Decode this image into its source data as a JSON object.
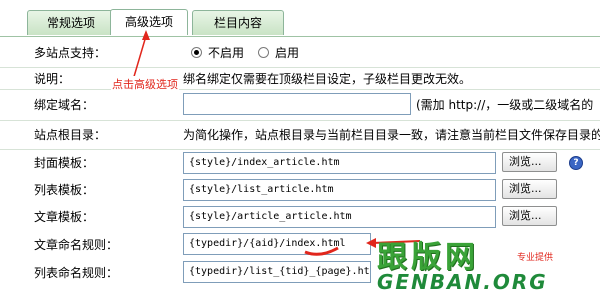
{
  "tabs": [
    {
      "label": "常规选项",
      "active": false
    },
    {
      "label": "高级选项",
      "active": true
    },
    {
      "label": "栏目内容",
      "active": false
    }
  ],
  "multisite": {
    "label": "多站点支持：",
    "options": [
      {
        "label": "不启用",
        "checked": true
      },
      {
        "label": "启用",
        "checked": false
      }
    ]
  },
  "note": {
    "label": "说明：",
    "text": "绑名绑定仅需要在顶级栏目设定，子级栏目更改无效。"
  },
  "domain": {
    "label": "绑定域名：",
    "value": "",
    "hint": "(需加 http://，一级或二级域名的"
  },
  "root": {
    "label": "站点根目录：",
    "text": "为简化操作，站点根目录与当前栏目目录一致，请注意当前栏目文件保存目录的"
  },
  "templates": {
    "cover": {
      "label": "封面模板：",
      "value": "{style}/index_article.htm",
      "browse": "浏览..."
    },
    "list": {
      "label": "列表模板：",
      "value": "{style}/list_article.htm",
      "browse": "浏览..."
    },
    "article": {
      "label": "文章模板：",
      "value": "{style}/article_article.htm",
      "browse": "浏览..."
    }
  },
  "naming": {
    "article": {
      "label": "文章命名规则：",
      "value": "{typedir}/{aid}/index.html"
    },
    "list": {
      "label": "列表命名规则：",
      "value": "{typedir}/list_{tid}_{page}.html"
    }
  },
  "help_icon": "?",
  "annotation": "点击高级选项",
  "watermark": {
    "cn": "跟版网",
    "en": "GENBAN.ORG",
    "small": "专业提供"
  },
  "colors": {
    "annotation_red": "#e1261c",
    "tab_green": "#c9e3c5",
    "watermark_green": "#3aa338"
  }
}
